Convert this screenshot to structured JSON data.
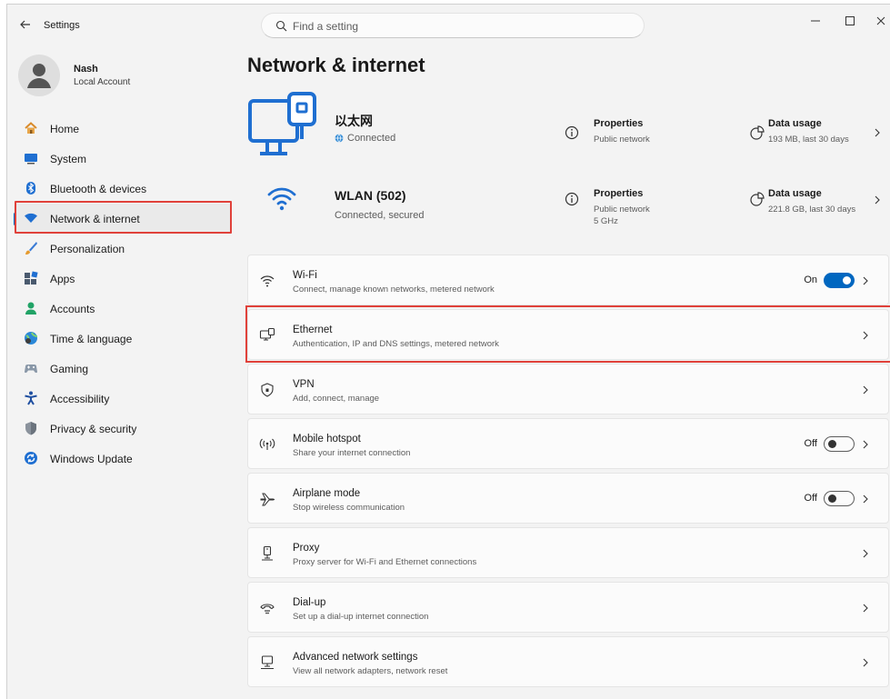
{
  "window": {
    "title": "Settings",
    "search_placeholder": "Find a setting"
  },
  "profile": {
    "name": "Nash",
    "account_type": "Local Account"
  },
  "sidebar": {
    "items": [
      {
        "label": "Home",
        "icon": "home-icon"
      },
      {
        "label": "System",
        "icon": "system-icon"
      },
      {
        "label": "Bluetooth & devices",
        "icon": "bluetooth-icon"
      },
      {
        "label": "Network & internet",
        "icon": "network-icon",
        "active": true
      },
      {
        "label": "Personalization",
        "icon": "brush-icon"
      },
      {
        "label": "Apps",
        "icon": "apps-icon"
      },
      {
        "label": "Accounts",
        "icon": "accounts-icon"
      },
      {
        "label": "Time & language",
        "icon": "globe-clock-icon"
      },
      {
        "label": "Gaming",
        "icon": "gamepad-icon"
      },
      {
        "label": "Accessibility",
        "icon": "accessibility-icon"
      },
      {
        "label": "Privacy & security",
        "icon": "shield-icon"
      },
      {
        "label": "Windows Update",
        "icon": "update-icon"
      }
    ]
  },
  "main": {
    "title": "Network & internet",
    "connections": {
      "ethernet": {
        "name": "以太网",
        "status": "Connected",
        "properties_title": "Properties",
        "properties_sub": "Public network",
        "usage_title": "Data usage",
        "usage_sub": "193 MB, last 30 days"
      },
      "wlan": {
        "name": "WLAN (502)",
        "status": "Connected, secured",
        "properties_title": "Properties",
        "properties_sub": "Public network",
        "properties_sub2": "5 GHz",
        "usage_title": "Data usage",
        "usage_sub": "221.8 GB, last 30 days"
      }
    },
    "rows": [
      {
        "title": "Wi-Fi",
        "subtitle": "Connect, manage known networks, metered network",
        "toggle": "On"
      },
      {
        "title": "Ethernet",
        "subtitle": "Authentication, IP and DNS settings, metered network"
      },
      {
        "title": "VPN",
        "subtitle": "Add, connect, manage"
      },
      {
        "title": "Mobile hotspot",
        "subtitle": "Share your internet connection",
        "toggle": "Off"
      },
      {
        "title": "Airplane mode",
        "subtitle": "Stop wireless communication",
        "toggle": "Off"
      },
      {
        "title": "Proxy",
        "subtitle": "Proxy server for Wi-Fi and Ethernet connections"
      },
      {
        "title": "Dial-up",
        "subtitle": "Set up a dial-up internet connection"
      },
      {
        "title": "Advanced network settings",
        "subtitle": "View all network adapters, network reset"
      }
    ]
  },
  "colors": {
    "accent": "#0067c0",
    "highlight": "#e0413a",
    "connected_globe": "#3a8fd6"
  }
}
